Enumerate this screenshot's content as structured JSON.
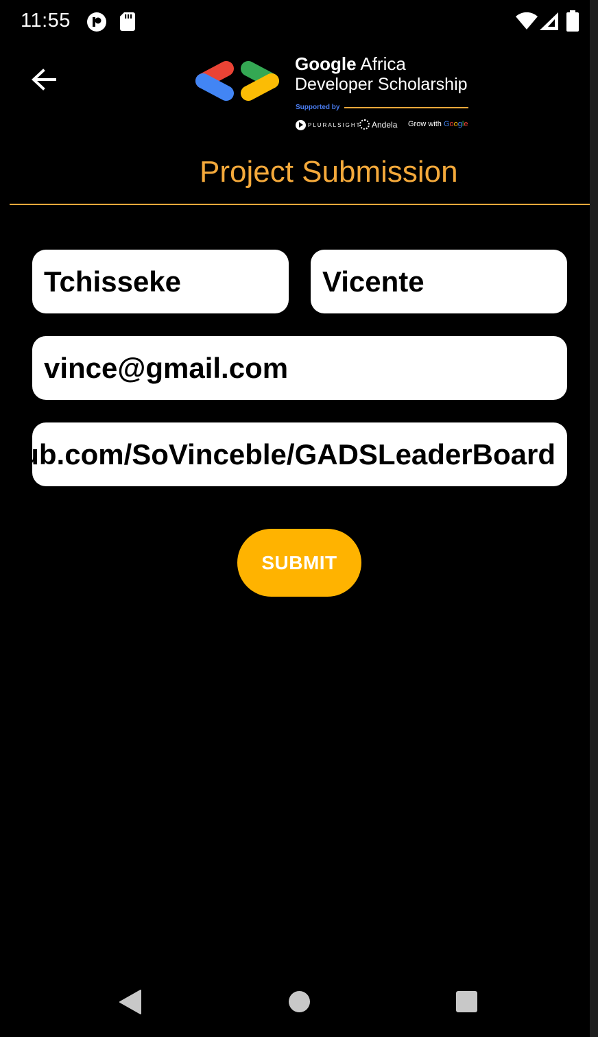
{
  "status_bar": {
    "time": "11:55",
    "icons": [
      "notification-app-icon",
      "sd-card-icon",
      "wifi-icon",
      "signal-icon",
      "battery-icon"
    ]
  },
  "header": {
    "back_icon": "arrow-left-icon",
    "logo": {
      "line1_bold": "Google",
      "line1_rest": " Africa",
      "line2": "Developer Scholarship",
      "supported_by": "Supported by",
      "partners": {
        "pluralsight": "PLURALSIGHT",
        "andela": "Andela",
        "grow_prefix": "Grow with ",
        "grow_google": [
          "G",
          "o",
          "o",
          "g",
          "l",
          "e"
        ]
      },
      "colors": {
        "red": "#EA4335",
        "blue": "#4285F4",
        "green": "#34A853",
        "yellow": "#FBBC05"
      }
    },
    "title": "Project Submission"
  },
  "form": {
    "first_name": "Tchisseke",
    "last_name": "Vicente",
    "email": "vince@gmail.com",
    "project_link": "https://github.com/SoVinceble/GADSLeaderBoard",
    "submit_label": "SUBMIT"
  },
  "navigation": {
    "icons": [
      "nav-back-icon",
      "nav-home-icon",
      "nav-recents-icon"
    ]
  },
  "colors": {
    "accent": "#f4a93b",
    "button": "#ffb300",
    "background": "#000000"
  }
}
